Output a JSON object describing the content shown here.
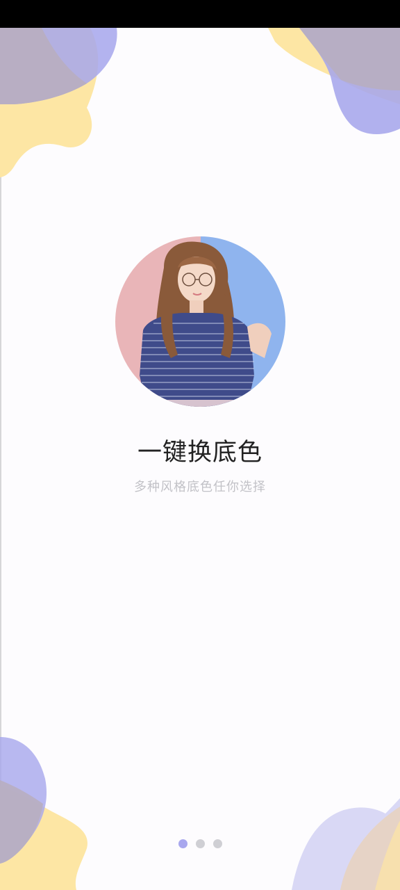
{
  "onboarding": {
    "title": "一键换底色",
    "subtitle": "多种风格底色任你选择",
    "pager": {
      "total": 3,
      "active": 1
    }
  },
  "colors": {
    "status_bar": "#000000",
    "background": "#fdfcfe",
    "blob_yellow": "#fde6a4",
    "blob_purple": "#a6a6ec",
    "blob_overlap": "#b8aec0",
    "photo_bg_pink": "#e9b5b8",
    "photo_bg_blue": "#8fb4ee",
    "dot_active": "#a8a7ee",
    "dot_inactive": "#cfcfd4"
  },
  "images": {
    "hero_photo": "portrait-with-split-background"
  }
}
